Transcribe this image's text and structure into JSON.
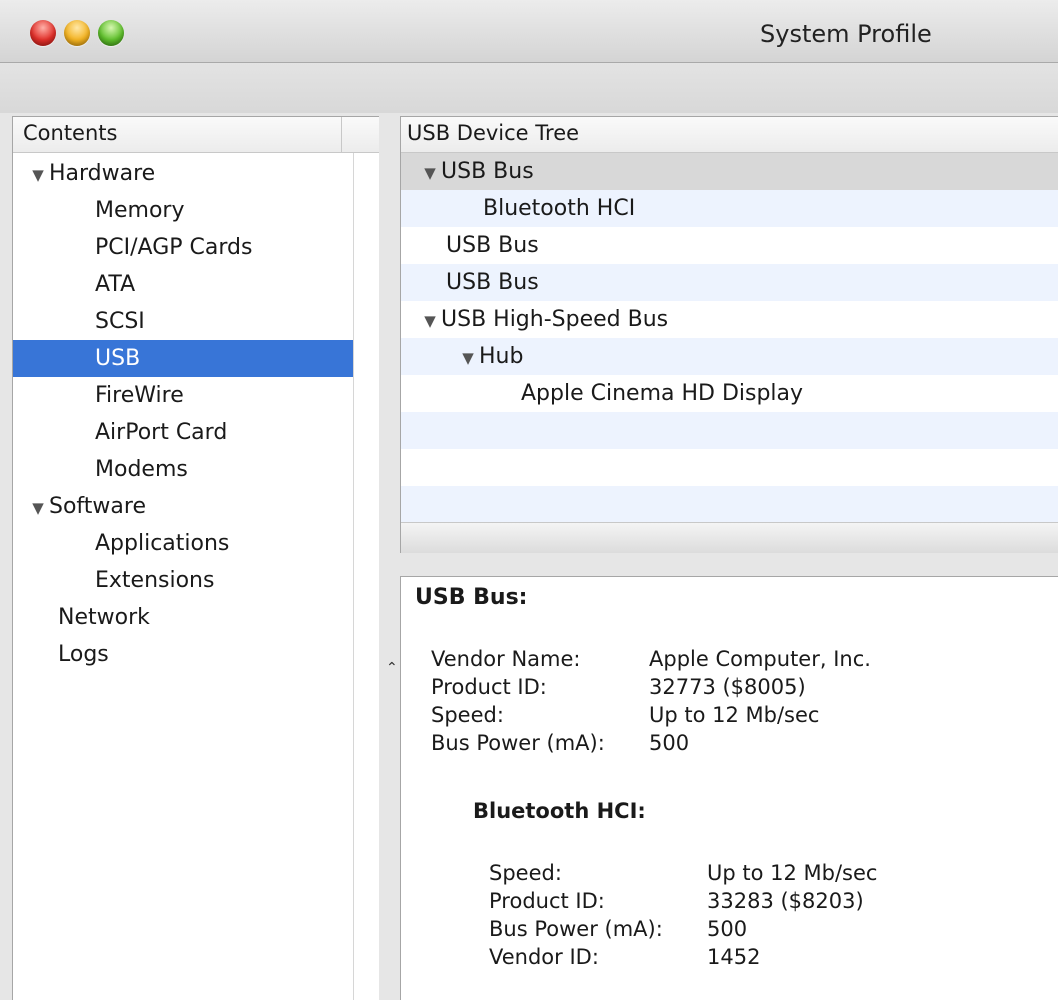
{
  "window": {
    "title": "System Profile"
  },
  "sidebar": {
    "column_label": "Contents",
    "items": [
      {
        "label": "Hardware",
        "disclosure": "▼"
      },
      {
        "label": "Memory"
      },
      {
        "label": "PCI/AGP Cards"
      },
      {
        "label": "ATA"
      },
      {
        "label": "SCSI"
      },
      {
        "label": "USB",
        "selected": true
      },
      {
        "label": "FireWire"
      },
      {
        "label": "AirPort Card"
      },
      {
        "label": "Modems"
      },
      {
        "label": "Software",
        "disclosure": "▼"
      },
      {
        "label": "Applications"
      },
      {
        "label": "Extensions"
      },
      {
        "label": "Network"
      },
      {
        "label": "Logs"
      }
    ]
  },
  "tree": {
    "column_label": "USB Device Tree",
    "rows": [
      {
        "label": "USB Bus",
        "disclosure": "▼"
      },
      {
        "label": "Bluetooth HCI"
      },
      {
        "label": "USB Bus"
      },
      {
        "label": "USB Bus"
      },
      {
        "label": "USB High-Speed Bus",
        "disclosure": "▼"
      },
      {
        "label": "Hub",
        "disclosure": "▼"
      },
      {
        "label": "Apple Cinema HD Display"
      }
    ]
  },
  "details": {
    "title": "USB Bus:",
    "fields": [
      {
        "key": "Vendor Name:",
        "value": "Apple Computer, Inc."
      },
      {
        "key": "Product ID:",
        "value": "32773 ($8005)"
      },
      {
        "key": "Speed:",
        "value": "Up to 12 Mb/sec"
      },
      {
        "key": "Bus Power (mA):",
        "value": "500"
      }
    ],
    "child": {
      "title": "Bluetooth HCI:",
      "fields": [
        {
          "key": "Speed:",
          "value": "Up to 12 Mb/sec"
        },
        {
          "key": "Product ID:",
          "value": "33283 ($8203)"
        },
        {
          "key": "Bus Power (mA):",
          "value": "500"
        },
        {
          "key": "Vendor ID:",
          "value": "1452"
        }
      ]
    }
  },
  "colors": {
    "selection": "#3875d7",
    "alt_row": "#edf3fe"
  }
}
